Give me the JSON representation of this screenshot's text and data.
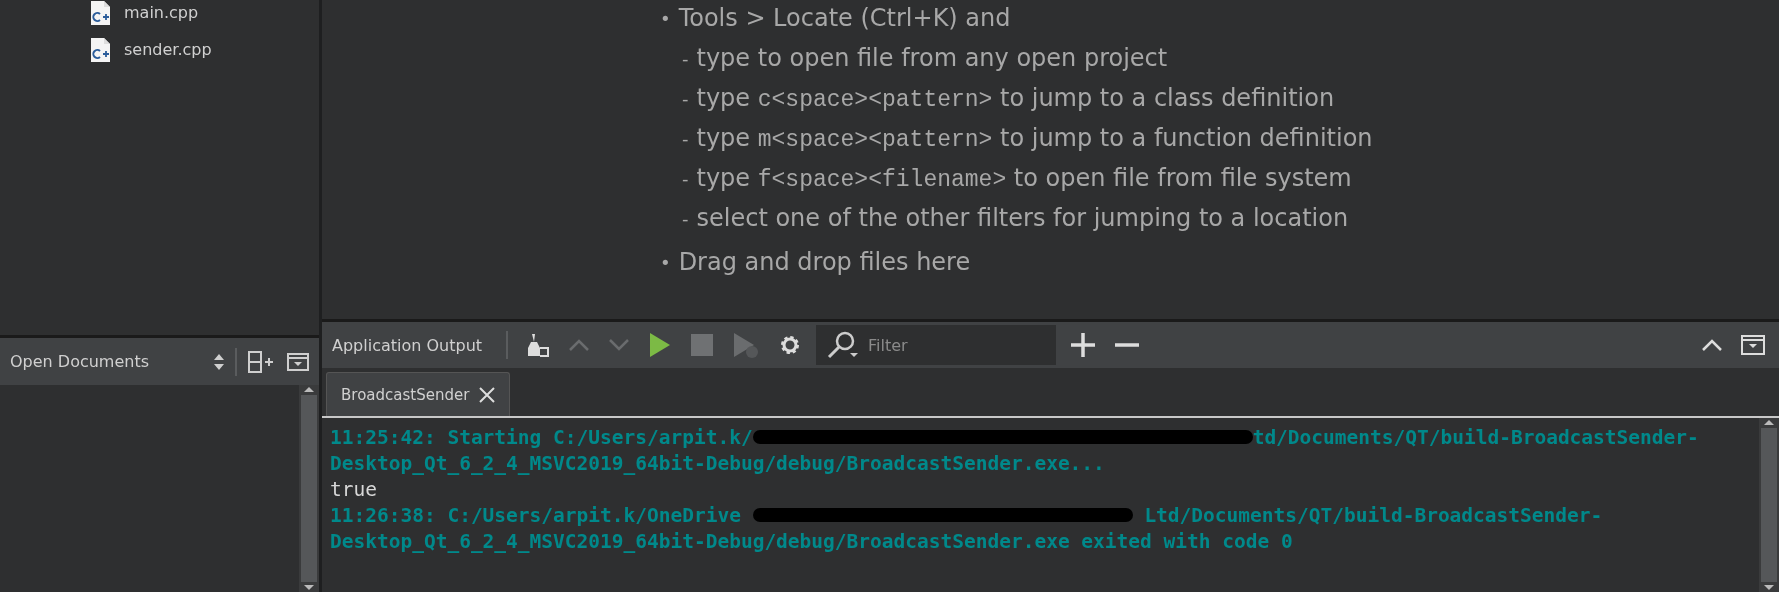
{
  "project_tree": {
    "items": [
      {
        "label": "main.cpp"
      },
      {
        "label": "sender.cpp"
      }
    ]
  },
  "open_documents": {
    "title": "Open Documents"
  },
  "welcome_hints": [
    {
      "kind": "bullet",
      "marker": "•",
      "parts": [
        {
          "kind": "text",
          "text": "Tools > Locate (Ctrl+K) and"
        }
      ]
    },
    {
      "kind": "sub",
      "marker": "-",
      "parts": [
        {
          "kind": "text",
          "text": "type to open file from any open project"
        }
      ]
    },
    {
      "kind": "sub",
      "marker": "-",
      "parts": [
        {
          "kind": "text",
          "text": "type "
        },
        {
          "kind": "code",
          "text": "c<space><pattern>"
        },
        {
          "kind": "text",
          "text": " to jump to a class definition"
        }
      ]
    },
    {
      "kind": "sub",
      "marker": "-",
      "parts": [
        {
          "kind": "text",
          "text": "type "
        },
        {
          "kind": "code",
          "text": "m<space><pattern>"
        },
        {
          "kind": "text",
          "text": " to jump to a function definition"
        }
      ]
    },
    {
      "kind": "sub",
      "marker": "-",
      "parts": [
        {
          "kind": "text",
          "text": "type "
        },
        {
          "kind": "code",
          "text": "f<space><filename>"
        },
        {
          "kind": "text",
          "text": " to open file from file system"
        }
      ]
    },
    {
      "kind": "sub",
      "marker": "-",
      "parts": [
        {
          "kind": "text",
          "text": "select one of the other filters for jumping to a location"
        }
      ]
    },
    {
      "kind": "bullet",
      "marker": "•",
      "parts": [
        {
          "kind": "text",
          "text": "Drag and drop files here"
        }
      ]
    }
  ],
  "output_pane": {
    "title": "Application Output",
    "filter": {
      "placeholder": "Filter"
    },
    "tabs": [
      {
        "label": "BroadcastSender",
        "selected": true
      }
    ],
    "lines": [
      {
        "kind": "status",
        "parts": [
          {
            "kind": "text",
            "text": "11:25:42: Starting C:/Users/arpit.k/"
          },
          {
            "kind": "redaction"
          },
          {
            "kind": "text",
            "text": "td/Documents/QT/build-BroadcastSender-"
          }
        ]
      },
      {
        "kind": "status",
        "parts": [
          {
            "kind": "text",
            "text": "Desktop_Qt_6_2_4_MSVC2019_64bit-Debug/debug/BroadcastSender.exe..."
          }
        ]
      },
      {
        "kind": "plain",
        "parts": [
          {
            "kind": "text",
            "text": "true"
          }
        ]
      },
      {
        "kind": "status",
        "parts": [
          {
            "kind": "text",
            "text": "11:26:38: C:/Users/arpit.k/OneDrive "
          },
          {
            "kind": "redaction"
          },
          {
            "kind": "text",
            "text": " Ltd/Documents/QT/build-BroadcastSender-"
          }
        ]
      },
      {
        "kind": "status",
        "parts": [
          {
            "kind": "text",
            "text": "Desktop_Qt_6_2_4_MSVC2019_64bit-Debug/debug/BroadcastSender.exe exited with code 0"
          }
        ]
      }
    ]
  }
}
